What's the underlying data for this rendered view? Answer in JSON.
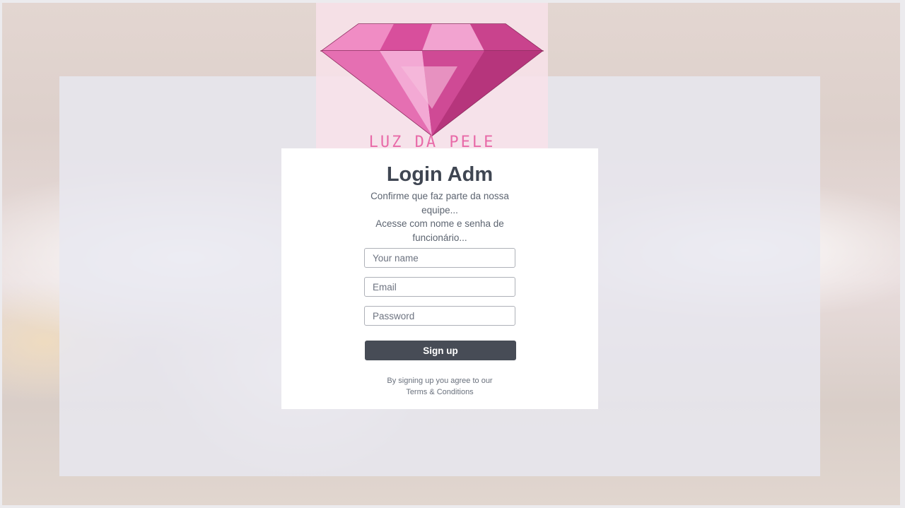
{
  "brand": {
    "logo_text": "LUZ DA PELE",
    "accent_color": "#e86aa8",
    "logo_icon": "diamond-icon"
  },
  "form": {
    "title": "Login Adm",
    "description_line1": "Confirme que faz parte da nossa equipe...",
    "description_line2": "Acesse com nome e senha de funcionário...",
    "name_placeholder": "Your name",
    "email_placeholder": "Email",
    "password_placeholder": "Password",
    "submit_label": "Sign up",
    "submit_color": "#474c56",
    "agreement_text": "By signing up you agree to our",
    "terms_link": "Terms & Conditions"
  }
}
